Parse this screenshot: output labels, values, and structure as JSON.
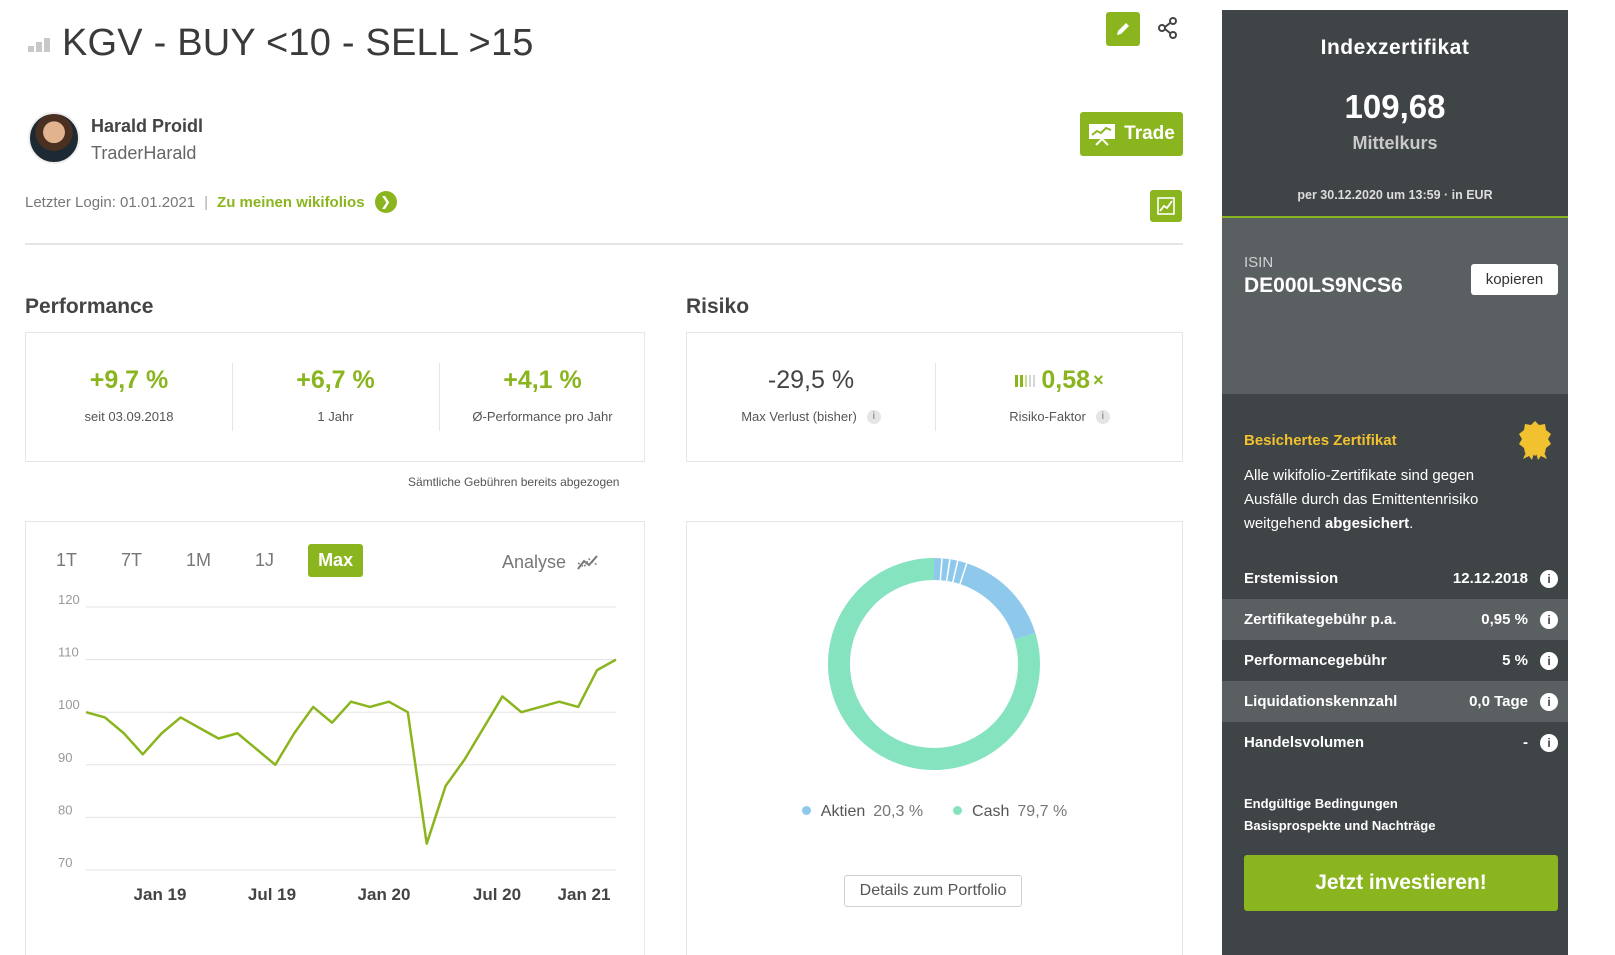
{
  "header": {
    "title": "KGV - BUY <10 - SELL >15"
  },
  "trader": {
    "name": "Harald Proidl",
    "nickname": "TraderHarald",
    "last_login_label": "Letzter Login: 01.01.2021",
    "separator": "|",
    "my_wikifolios_link": "Zu meinen wikifolios"
  },
  "buttons": {
    "trade": "Trade",
    "details_portfolio": "Details zum Portfolio",
    "copy": "kopieren",
    "invest": "Jetzt investieren!"
  },
  "performance": {
    "heading": "Performance",
    "kpis": [
      {
        "value": "+9,7 %",
        "label": "seit 03.09.2018"
      },
      {
        "value": "+6,7 %",
        "label": "1 Jahr"
      },
      {
        "value": "+4,1 %",
        "label": "Ø-Performance pro Jahr"
      }
    ],
    "fees_note": "Sämtliche Gebühren bereits abgezogen"
  },
  "risk": {
    "heading": "Risiko",
    "max_loss": {
      "value": "-29,5 %",
      "label": "Max Verlust (bisher)"
    },
    "risk_factor": {
      "value": "0,58",
      "suffix": "×",
      "label": "Risiko-Faktor"
    }
  },
  "chart_tabs": [
    "1T",
    "7T",
    "1M",
    "1J",
    "Max"
  ],
  "chart_active_tab": "Max",
  "analyse_label": "Analyse",
  "chart_data": [
    {
      "type": "line",
      "x_tick_labels": [
        "Jan 19",
        "Jul 19",
        "Jan 20",
        "Jul 20",
        "Jan 21"
      ],
      "y_tick_labels": [
        "120",
        "110",
        "100",
        "90",
        "80",
        "70"
      ],
      "ylim": [
        70,
        120
      ],
      "grid": true,
      "line_color": "#8ab51f",
      "series": [
        {
          "x": [
            "2018-09",
            "2018-10",
            "2018-11",
            "2018-12",
            "2019-01",
            "2019-02",
            "2019-03",
            "2019-04",
            "2019-05",
            "2019-06",
            "2019-07",
            "2019-08",
            "2019-09",
            "2019-10",
            "2019-11",
            "2019-12",
            "2020-01",
            "2020-02",
            "2020-03",
            "2020-04",
            "2020-05",
            "2020-06",
            "2020-07",
            "2020-08",
            "2020-09",
            "2020-10",
            "2020-11",
            "2020-12",
            "2021-01"
          ],
          "values": [
            100,
            99,
            96,
            92,
            96,
            99,
            97,
            95,
            96,
            93,
            90,
            96,
            101,
            98,
            102,
            101,
            102,
            100,
            75,
            86,
            91,
            97,
            103,
            100,
            101,
            102,
            101,
            108,
            110
          ]
        }
      ]
    },
    {
      "type": "pie",
      "donut": true,
      "categories": [
        "Aktien",
        "Cash"
      ],
      "values": [
        20.3,
        79.7
      ],
      "colors": [
        "#8ec9ec",
        "#86e3c0"
      ]
    }
  ],
  "allocation_legend": [
    {
      "name": "Aktien",
      "pct": "20,3 %",
      "color": "#8ec9ec"
    },
    {
      "name": "Cash",
      "pct": "79,7 %",
      "color": "#86e3c0"
    }
  ],
  "sidebar": {
    "title": "Indexzertifikat",
    "price": "109,68",
    "price_label": "Mittelkurs",
    "date_note": "per 30.12.2020 um 13:59 · in EUR",
    "isin_label": "ISIN",
    "isin": "DE000LS9NCS6",
    "secured_title": "Besichertes Zertifikat",
    "secured_text_before": "Alle wikifolio-Zertifikate sind gegen Ausfälle durch das Emittentenrisiko weitgehend ",
    "secured_text_bold": "abgesichert",
    "secured_text_after": ".",
    "facts": [
      {
        "key": "Erstemission",
        "value": "12.12.2018"
      },
      {
        "key": "Zertifikategebühr p.a.",
        "value": "0,95 %"
      },
      {
        "key": "Performancegebühr",
        "value": "5 %"
      },
      {
        "key": "Liquidationskennzahl",
        "value": "0,0 Tage"
      },
      {
        "key": "Handelsvolumen",
        "value": "-"
      }
    ],
    "links": [
      "Endgültige Bedingungen",
      "Basisprospekte und Nachträge"
    ]
  },
  "colors": {
    "accent_green": "#8ab51f",
    "sidebar_bg": "#3f4447",
    "sidebar_alt": "#5a5f62",
    "gold": "#f2c130"
  }
}
